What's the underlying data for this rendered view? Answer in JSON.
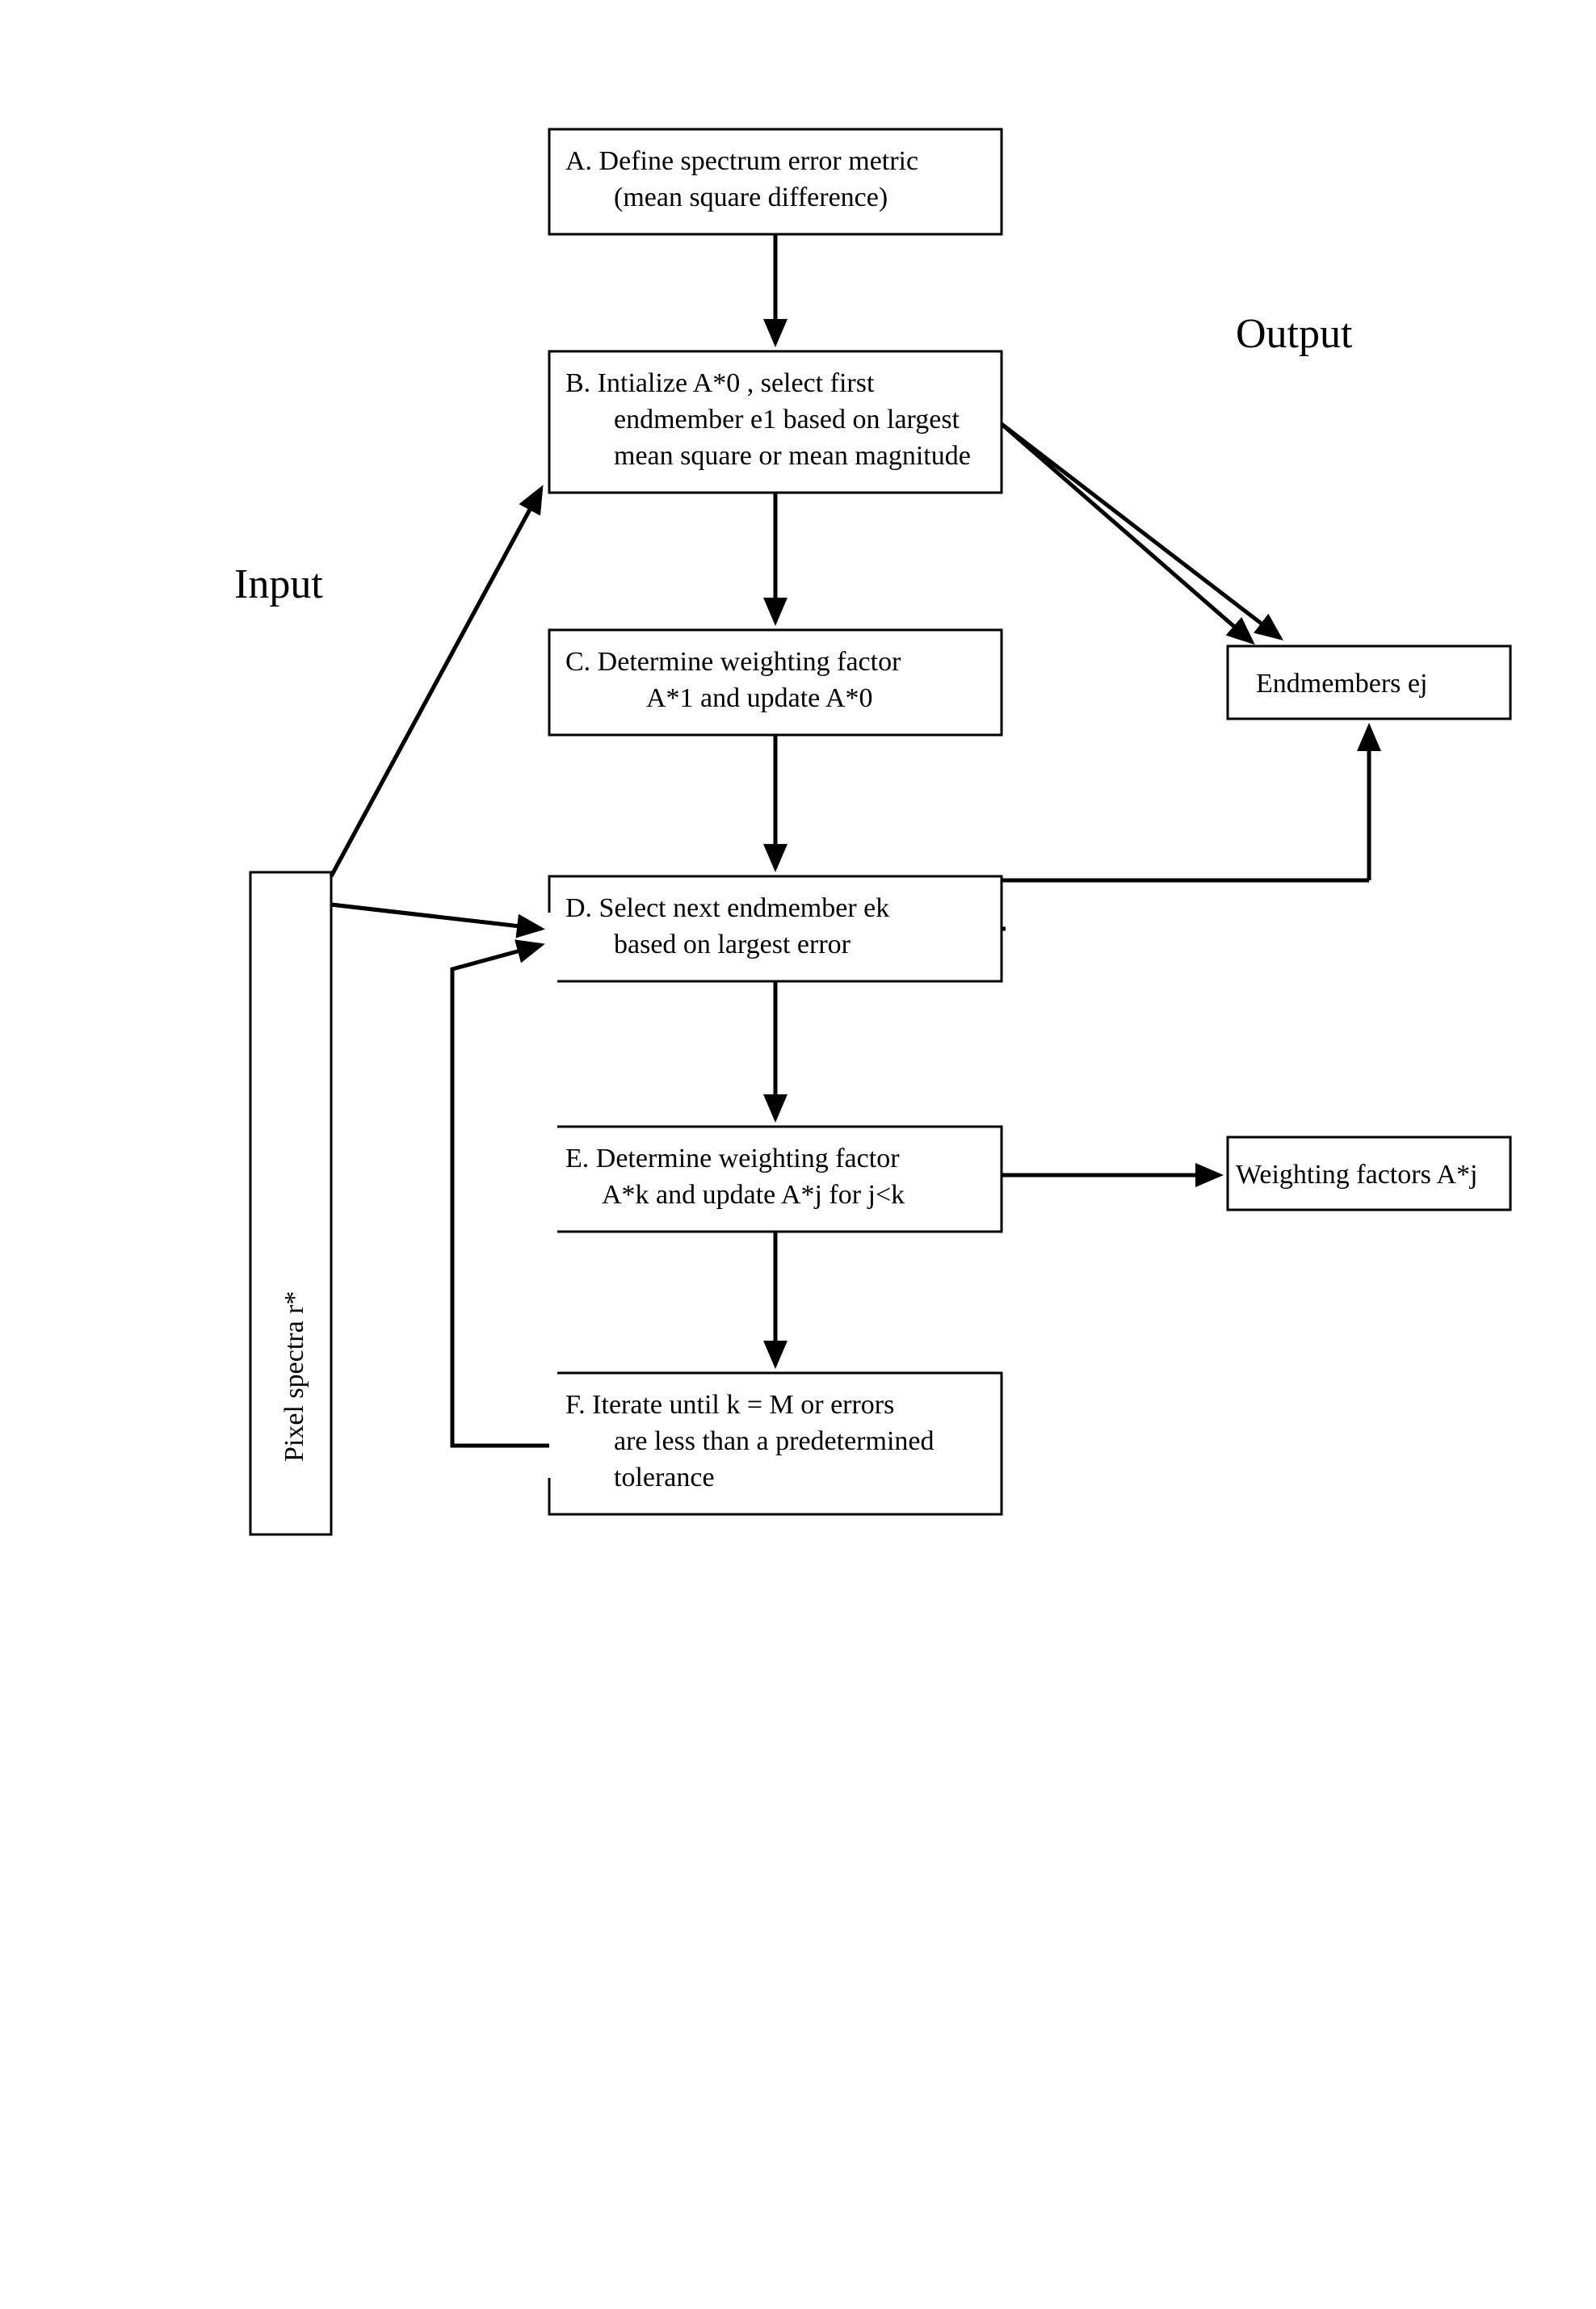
{
  "headers": {
    "input": "Input",
    "output": "Output"
  },
  "pixelSpectra": {
    "line": "Pixel spectra r*"
  },
  "boxA": {
    "l1": "A.  Define spectrum error metric",
    "l2": "(mean square difference)"
  },
  "boxB": {
    "l1": "B.  Intialize A*0 , select first",
    "l2": "endmember e1 based on largest",
    "l3": "mean square or mean magnitude"
  },
  "boxC": {
    "l1": "C.  Determine weighting factor",
    "l2": "A*1 and update A*0"
  },
  "boxD": {
    "l1": "D.  Select next endmember ek",
    "l2": "based on largest error"
  },
  "boxE": {
    "l1": "E.  Determine weighting factor",
    "l2": "A*k and update A*j for j<k"
  },
  "boxF": {
    "l1": "F.  Iterate until k = M or errors",
    "l2": "are less than a predetermined",
    "l3": "tolerance"
  },
  "outEndmembers": {
    "line": "Endmembers ej"
  },
  "outWeighting": {
    "line": "Weighting factors A*j"
  },
  "chart_data": {
    "type": "flowchart",
    "nodes": [
      {
        "id": "input",
        "label": "Pixel spectra r*",
        "kind": "input"
      },
      {
        "id": "A",
        "label": "A. Define spectrum error metric (mean square difference)"
      },
      {
        "id": "B",
        "label": "B. Initialize A*0, select first endmember e1 based on largest mean square or mean magnitude"
      },
      {
        "id": "C",
        "label": "C. Determine weighting factor A*1 and update A*0"
      },
      {
        "id": "D",
        "label": "D. Select next endmember ek based on largest error"
      },
      {
        "id": "E",
        "label": "E. Determine weighting factor A*k and update A*j for j<k"
      },
      {
        "id": "F",
        "label": "F. Iterate until k = M or errors are less than a predetermined tolerance"
      },
      {
        "id": "out_e",
        "label": "Endmembers ej",
        "kind": "output"
      },
      {
        "id": "out_A",
        "label": "Weighting factors A*j",
        "kind": "output"
      }
    ],
    "edges": [
      {
        "from": "A",
        "to": "B"
      },
      {
        "from": "B",
        "to": "C"
      },
      {
        "from": "C",
        "to": "D"
      },
      {
        "from": "D",
        "to": "E"
      },
      {
        "from": "E",
        "to": "F"
      },
      {
        "from": "F",
        "to": "D",
        "kind": "loop"
      },
      {
        "from": "input",
        "to": "B"
      },
      {
        "from": "input",
        "to": "D"
      },
      {
        "from": "B",
        "to": "out_e"
      },
      {
        "from": "D",
        "to": "out_e"
      },
      {
        "from": "E",
        "to": "out_A"
      }
    ],
    "title": "",
    "section_labels": {
      "left": "Input",
      "right": "Output"
    }
  }
}
